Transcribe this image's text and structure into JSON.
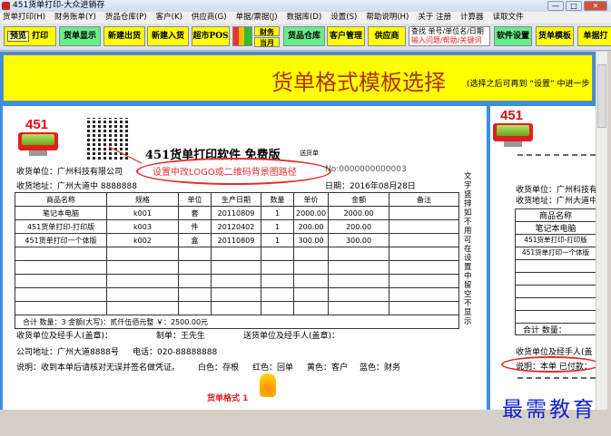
{
  "window": {
    "title": "451货单打印-大众进销存",
    "buttons": [
      "—",
      "□",
      "✕"
    ]
  },
  "menu": [
    "货单打印(H)",
    "财务账单(Y)",
    "货品仓库(P)",
    "客户(K)",
    "供应商(G)",
    "单据/票据(J)",
    "数据库(D)",
    "设置(S)",
    "帮助说明(H)",
    "关于 注册",
    "计算器",
    "读取文件"
  ],
  "toolbar": {
    "preview": "预览",
    "print": "打印",
    "show": "货单显示",
    "new_out": "新建出货",
    "new_in": "新建入货",
    "pos": "超市POS",
    "finance": "财务",
    "month": "当月",
    "stock": "货品仓库",
    "customers": "客户管理",
    "supplier": "供应商",
    "search_line1": "查找 单号/单位名/日期",
    "search_line2": "输入问题/帮助/关键词",
    "settings": "软件设置",
    "template": "货单模板",
    "docs": "单据打"
  },
  "banner": {
    "title": "货单格式模板选择",
    "note": "(选择之后可再到 “设置” 中进一步"
  },
  "invoice": {
    "logo": "451",
    "title": "451货单打印软件 免费版",
    "subtitle": "送货单",
    "annotation": "设置中改LOGO或二维码背景图路径",
    "no": "No:0000000000003",
    "receiver": "收货单位：广州科技有限公司",
    "address": "收货地址：广州大道中  8888888",
    "date": "日期：2016年08月28日",
    "headers": [
      "商品名称",
      "规格",
      "单位",
      "生产日期",
      "数量",
      "单价",
      "金额",
      "备注"
    ],
    "rows": [
      [
        "笔记本电脑",
        "k001",
        "套",
        "20110809",
        "1",
        "2000.00",
        "2000.00",
        ""
      ],
      [
        "451货单打印-打印版",
        "k003",
        "件",
        "20120402",
        "1",
        "200.00",
        "200.00",
        ""
      ],
      [
        "451货单打印一个体版",
        "k002",
        "盒",
        "20110809",
        "1",
        "300.00",
        "300.00",
        ""
      ]
    ],
    "total": "合计   数量：3     金额(大写)：贰仟伍佰元整      ￥：2500.00元",
    "sign_receiver": "收货单位及经手人(盖章)：",
    "maker": "制单：王先生",
    "sign_sender": "送货单位及经手人(盖章)：",
    "company_address": "公司地址：广州大道8888号",
    "phone": "电话：020-88888888",
    "note": "说明：收到本单后请核对无误并签名做凭证。",
    "copies": [
      "白色：存根",
      "红色：回单",
      "黄色：客户",
      "蓝色：财务"
    ],
    "vertical_text": "文字 竖排 如不用可在设置中留空不显示",
    "format_label": "货单格式 1"
  },
  "invoice2": {
    "logo": "451",
    "receiver": "收货单位：广州科技有",
    "address": "收货地址：广州大道中",
    "headers": [
      "商品名称"
    ],
    "rows": [
      "笔记本电脑",
      "451货单打印-打印版",
      "451货单打印一个体版"
    ],
    "total": "合计   数量：",
    "sign": "收货单位及经手人(盖",
    "note": "说明：本单 已付款："
  },
  "watermark": "最需教育"
}
